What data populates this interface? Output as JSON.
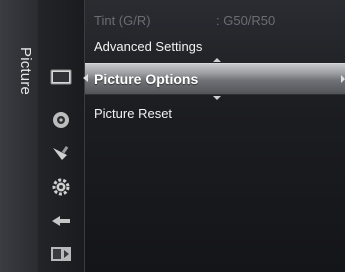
{
  "side_tab": {
    "label": "Picture"
  },
  "icons": [
    "picture-icon",
    "sound-icon",
    "channel-icon",
    "setup-icon",
    "input-icon",
    "application-icon"
  ],
  "menu": {
    "tint": {
      "label": "Tint (G/R)",
      "value": ": G50/R50"
    },
    "advanced_settings": "Advanced Settings",
    "picture_options": "Picture Options",
    "picture_reset": "Picture Reset"
  },
  "colors": {
    "selected_highlight": "#9ea0a4",
    "dim_text": "#6b6d73",
    "text": "#f2f2f2"
  }
}
